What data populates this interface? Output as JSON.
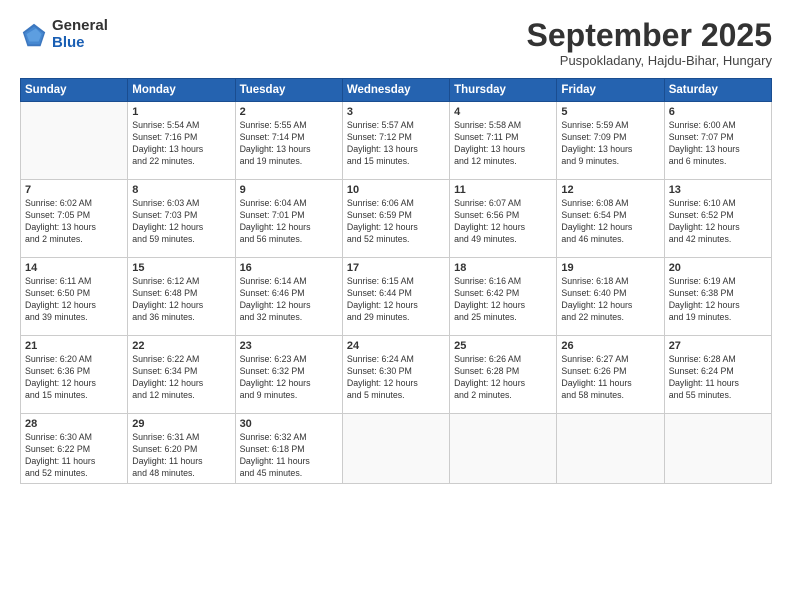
{
  "header": {
    "logo_general": "General",
    "logo_blue": "Blue",
    "month": "September 2025",
    "location": "Puspokladany, Hajdu-Bihar, Hungary"
  },
  "days_of_week": [
    "Sunday",
    "Monday",
    "Tuesday",
    "Wednesday",
    "Thursday",
    "Friday",
    "Saturday"
  ],
  "weeks": [
    [
      {
        "day": "",
        "info": ""
      },
      {
        "day": "1",
        "info": "Sunrise: 5:54 AM\nSunset: 7:16 PM\nDaylight: 13 hours\nand 22 minutes."
      },
      {
        "day": "2",
        "info": "Sunrise: 5:55 AM\nSunset: 7:14 PM\nDaylight: 13 hours\nand 19 minutes."
      },
      {
        "day": "3",
        "info": "Sunrise: 5:57 AM\nSunset: 7:12 PM\nDaylight: 13 hours\nand 15 minutes."
      },
      {
        "day": "4",
        "info": "Sunrise: 5:58 AM\nSunset: 7:11 PM\nDaylight: 13 hours\nand 12 minutes."
      },
      {
        "day": "5",
        "info": "Sunrise: 5:59 AM\nSunset: 7:09 PM\nDaylight: 13 hours\nand 9 minutes."
      },
      {
        "day": "6",
        "info": "Sunrise: 6:00 AM\nSunset: 7:07 PM\nDaylight: 13 hours\nand 6 minutes."
      }
    ],
    [
      {
        "day": "7",
        "info": "Sunrise: 6:02 AM\nSunset: 7:05 PM\nDaylight: 13 hours\nand 2 minutes."
      },
      {
        "day": "8",
        "info": "Sunrise: 6:03 AM\nSunset: 7:03 PM\nDaylight: 12 hours\nand 59 minutes."
      },
      {
        "day": "9",
        "info": "Sunrise: 6:04 AM\nSunset: 7:01 PM\nDaylight: 12 hours\nand 56 minutes."
      },
      {
        "day": "10",
        "info": "Sunrise: 6:06 AM\nSunset: 6:59 PM\nDaylight: 12 hours\nand 52 minutes."
      },
      {
        "day": "11",
        "info": "Sunrise: 6:07 AM\nSunset: 6:56 PM\nDaylight: 12 hours\nand 49 minutes."
      },
      {
        "day": "12",
        "info": "Sunrise: 6:08 AM\nSunset: 6:54 PM\nDaylight: 12 hours\nand 46 minutes."
      },
      {
        "day": "13",
        "info": "Sunrise: 6:10 AM\nSunset: 6:52 PM\nDaylight: 12 hours\nand 42 minutes."
      }
    ],
    [
      {
        "day": "14",
        "info": "Sunrise: 6:11 AM\nSunset: 6:50 PM\nDaylight: 12 hours\nand 39 minutes."
      },
      {
        "day": "15",
        "info": "Sunrise: 6:12 AM\nSunset: 6:48 PM\nDaylight: 12 hours\nand 36 minutes."
      },
      {
        "day": "16",
        "info": "Sunrise: 6:14 AM\nSunset: 6:46 PM\nDaylight: 12 hours\nand 32 minutes."
      },
      {
        "day": "17",
        "info": "Sunrise: 6:15 AM\nSunset: 6:44 PM\nDaylight: 12 hours\nand 29 minutes."
      },
      {
        "day": "18",
        "info": "Sunrise: 6:16 AM\nSunset: 6:42 PM\nDaylight: 12 hours\nand 25 minutes."
      },
      {
        "day": "19",
        "info": "Sunrise: 6:18 AM\nSunset: 6:40 PM\nDaylight: 12 hours\nand 22 minutes."
      },
      {
        "day": "20",
        "info": "Sunrise: 6:19 AM\nSunset: 6:38 PM\nDaylight: 12 hours\nand 19 minutes."
      }
    ],
    [
      {
        "day": "21",
        "info": "Sunrise: 6:20 AM\nSunset: 6:36 PM\nDaylight: 12 hours\nand 15 minutes."
      },
      {
        "day": "22",
        "info": "Sunrise: 6:22 AM\nSunset: 6:34 PM\nDaylight: 12 hours\nand 12 minutes."
      },
      {
        "day": "23",
        "info": "Sunrise: 6:23 AM\nSunset: 6:32 PM\nDaylight: 12 hours\nand 9 minutes."
      },
      {
        "day": "24",
        "info": "Sunrise: 6:24 AM\nSunset: 6:30 PM\nDaylight: 12 hours\nand 5 minutes."
      },
      {
        "day": "25",
        "info": "Sunrise: 6:26 AM\nSunset: 6:28 PM\nDaylight: 12 hours\nand 2 minutes."
      },
      {
        "day": "26",
        "info": "Sunrise: 6:27 AM\nSunset: 6:26 PM\nDaylight: 11 hours\nand 58 minutes."
      },
      {
        "day": "27",
        "info": "Sunrise: 6:28 AM\nSunset: 6:24 PM\nDaylight: 11 hours\nand 55 minutes."
      }
    ],
    [
      {
        "day": "28",
        "info": "Sunrise: 6:30 AM\nSunset: 6:22 PM\nDaylight: 11 hours\nand 52 minutes."
      },
      {
        "day": "29",
        "info": "Sunrise: 6:31 AM\nSunset: 6:20 PM\nDaylight: 11 hours\nand 48 minutes."
      },
      {
        "day": "30",
        "info": "Sunrise: 6:32 AM\nSunset: 6:18 PM\nDaylight: 11 hours\nand 45 minutes."
      },
      {
        "day": "",
        "info": ""
      },
      {
        "day": "",
        "info": ""
      },
      {
        "day": "",
        "info": ""
      },
      {
        "day": "",
        "info": ""
      }
    ]
  ]
}
